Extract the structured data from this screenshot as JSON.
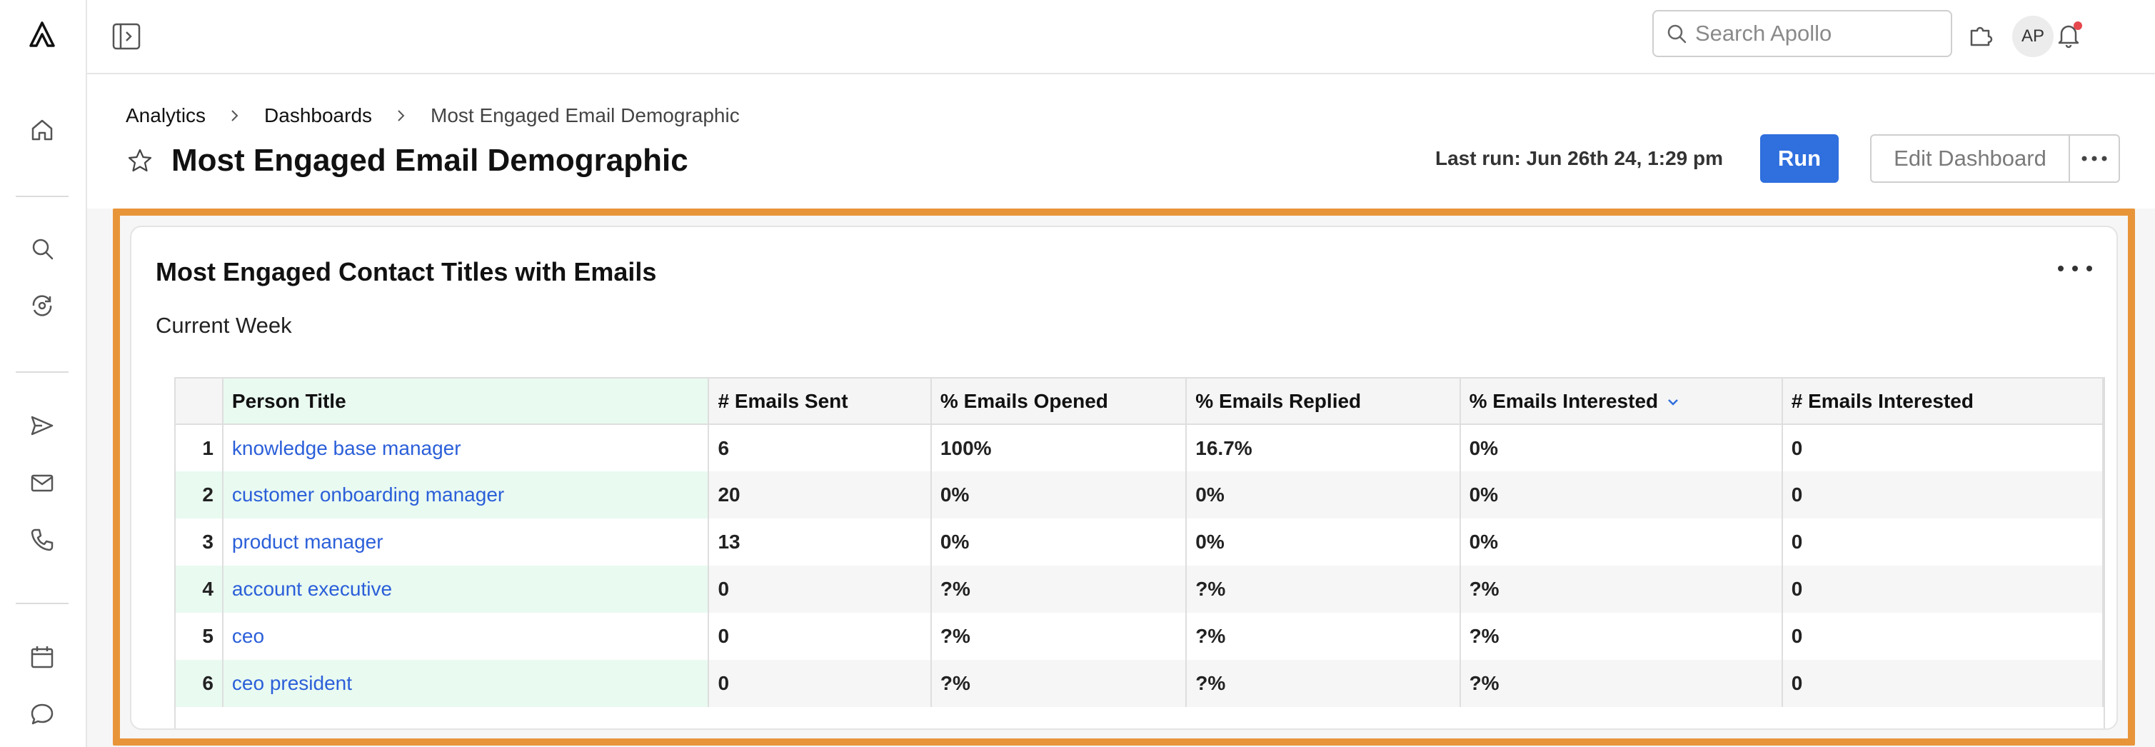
{
  "topbar": {
    "search_placeholder": "Search Apollo",
    "avatar_initials": "AP"
  },
  "breadcrumb": [
    "Analytics",
    "Dashboards",
    "Most Engaged Email Demographic"
  ],
  "header": {
    "title": "Most Engaged Email Demographic",
    "last_run": "Last run: Jun 26th 24, 1:29 pm",
    "run_label": "Run",
    "edit_label": "Edit Dashboard"
  },
  "card": {
    "title": "Most Engaged Contact Titles with Emails",
    "subtitle": "Current Week"
  },
  "table": {
    "columns": [
      "Person Title",
      "# Emails Sent",
      "% Emails Opened",
      "% Emails Replied",
      "% Emails Interested",
      "# Emails Interested"
    ],
    "rows": [
      {
        "index": "1",
        "title": "knowledge base manager",
        "sent": "6",
        "opened": "100%",
        "replied": "16.7%",
        "interested_pct": "0%",
        "interested": "0"
      },
      {
        "index": "2",
        "title": "customer onboarding manager",
        "sent": "20",
        "opened": "0%",
        "replied": "0%",
        "interested_pct": "0%",
        "interested": "0"
      },
      {
        "index": "3",
        "title": "product manager",
        "sent": "13",
        "opened": "0%",
        "replied": "0%",
        "interested_pct": "0%",
        "interested": "0"
      },
      {
        "index": "4",
        "title": "account executive",
        "sent": "0",
        "opened": "?%",
        "replied": "?%",
        "interested_pct": "?%",
        "interested": "0"
      },
      {
        "index": "5",
        "title": "ceo",
        "sent": "0",
        "opened": "?%",
        "replied": "?%",
        "interested_pct": "?%",
        "interested": "0"
      },
      {
        "index": "6",
        "title": "ceo president",
        "sent": "0",
        "opened": "?%",
        "replied": "?%",
        "interested_pct": "?%",
        "interested": "0"
      }
    ]
  },
  "colors": {
    "accent": "#2f6fde",
    "highlight": "#e8953a",
    "link": "#2b5fd9",
    "title_column_bg": "#e9faf1"
  }
}
